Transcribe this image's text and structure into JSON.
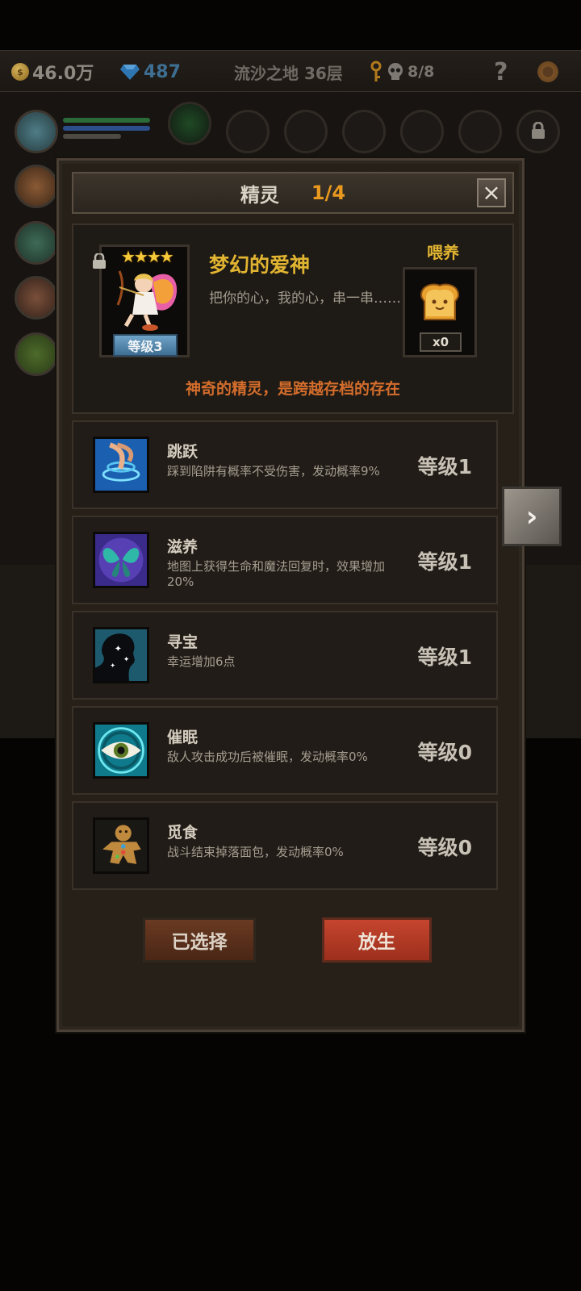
{
  "hud": {
    "gold": "46.0万",
    "gems": "487",
    "location": "流沙之地 36层",
    "keys_skulls": "8/8",
    "help": "?"
  },
  "dialog": {
    "title": "精灵",
    "page": "1/4",
    "close": "×"
  },
  "pet": {
    "stars": "★★★★",
    "level": "等级3",
    "name": "梦幻的爱神",
    "description": "把你的心，我的心，串一串……",
    "feed_label": "喂养",
    "feed_count": "x0",
    "note": "神奇的精灵，是跨越存档的存在"
  },
  "skills": [
    {
      "name": "跳跃",
      "desc": "踩到陷阱有概率不受伤害，发动概率9%",
      "level": "等级1",
      "icon": "jump-icon"
    },
    {
      "name": "滋养",
      "desc": "地图上获得生命和魔法回复时，效果增加20%",
      "level": "等级1",
      "icon": "nourish-icon"
    },
    {
      "name": "寻宝",
      "desc": "幸运增加6点",
      "level": "等级1",
      "icon": "treasure-hunt-icon"
    },
    {
      "name": "催眠",
      "desc": "敌人攻击成功后被催眠，发动概率0%",
      "level": "等级0",
      "icon": "hypnosis-eye-icon"
    },
    {
      "name": "觅食",
      "desc": "战斗结束掉落面包，发动概率0%",
      "level": "等级0",
      "icon": "gingerbread-icon"
    }
  ],
  "buttons": {
    "selected": "已选择",
    "release": "放生"
  },
  "colors": {
    "gold_accent": "#e1b431",
    "orange_accent": "#e99a1e",
    "note_color": "#d36d2c",
    "release_red": "#c5452e"
  }
}
